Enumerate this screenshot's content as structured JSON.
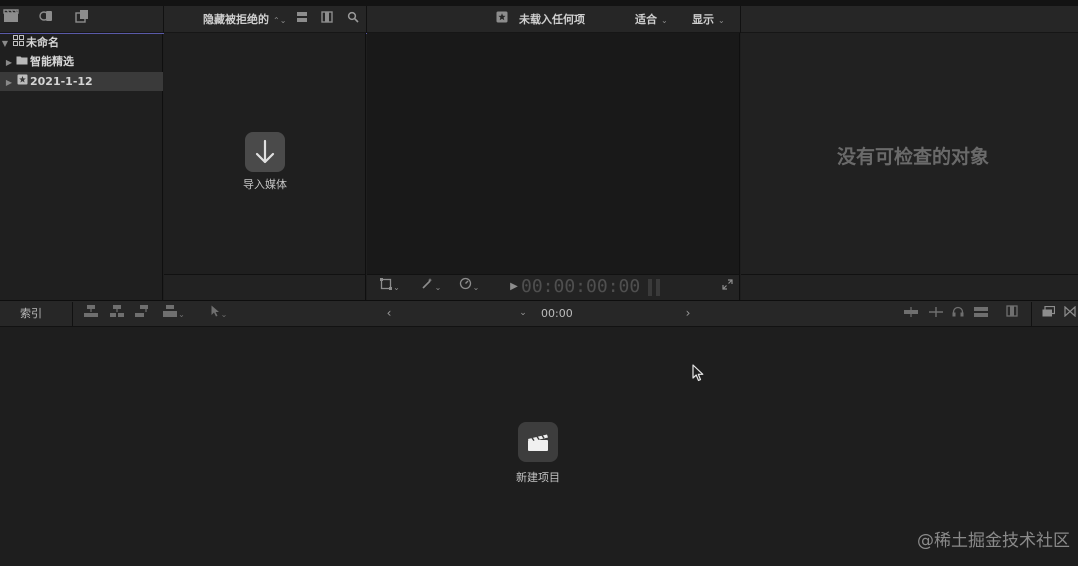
{
  "toolbar": {
    "filter_label": "隐藏被拒绝的",
    "viewer_title": "未载入任何项",
    "fit_label": "适合",
    "display_label": "显示"
  },
  "library": {
    "items": [
      {
        "label": "未命名",
        "icon": "library-grid-icon",
        "expanded": true
      },
      {
        "label": "智能精选",
        "icon": "folder-icon",
        "expanded": false
      },
      {
        "label": "2021-1-12",
        "icon": "event-star-icon",
        "expanded": false,
        "selected": true
      }
    ]
  },
  "browser": {
    "import_label": "导入媒体"
  },
  "viewer": {
    "timecode": "00:00:00:00"
  },
  "inspector": {
    "empty_message": "没有可检查的对象"
  },
  "timeline": {
    "index_label": "索引",
    "timecode": "00:00",
    "new_project_label": "新建项目"
  },
  "watermark": "@稀土掘金技术社区",
  "colors": {
    "background": "#1e1e1e",
    "toolbar": "#262626",
    "selection": "#3a3a3a",
    "accent_line": "#5a5aa8"
  }
}
